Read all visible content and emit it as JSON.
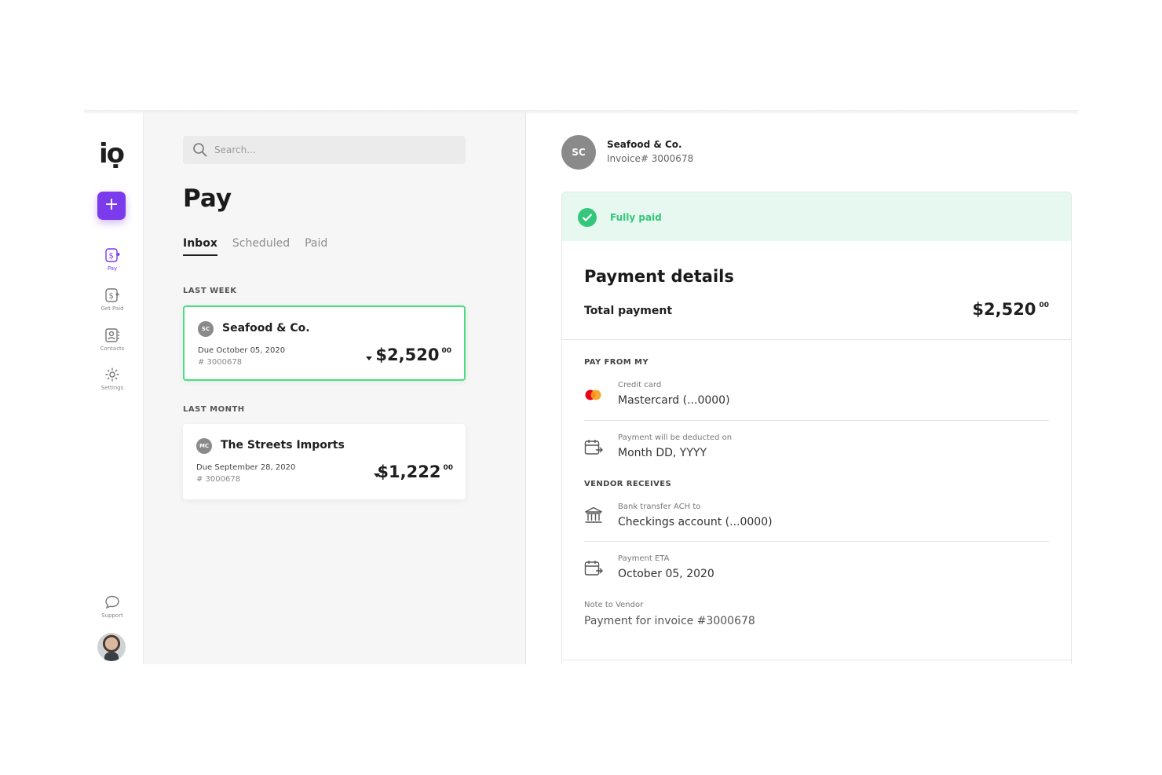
{
  "sidebar": {
    "logo": "iọ",
    "add_label": "+",
    "items": [
      {
        "label": "Pay",
        "icon": "pay-icon",
        "active": true
      },
      {
        "label": "Get Paid",
        "icon": "get-paid-icon",
        "active": false
      },
      {
        "label": "Contacts",
        "icon": "contacts-icon",
        "active": false
      },
      {
        "label": "Settings",
        "icon": "gear-icon",
        "active": false
      }
    ],
    "support_label": "Support"
  },
  "list": {
    "search_placeholder": "Search...",
    "title": "Pay",
    "tabs": [
      {
        "label": "Inbox",
        "active": true
      },
      {
        "label": "Scheduled",
        "active": false
      },
      {
        "label": "Paid",
        "active": false
      }
    ],
    "sections": [
      {
        "label": "LAST WEEK",
        "invoices": [
          {
            "initials": "SC",
            "vendor": "Seafood & Co.",
            "due": "Due October 05, 2020",
            "number": "# 3000678",
            "amount": "$2,520",
            "cents": "00",
            "selected": true
          }
        ]
      },
      {
        "label": "LAST MONTH",
        "invoices": [
          {
            "initials": "MC",
            "vendor": "The Streets Imports",
            "due": "Due September 28, 2020",
            "number": "# 3000678",
            "amount": "$1,222",
            "cents": "00",
            "selected": false
          }
        ]
      }
    ]
  },
  "detail": {
    "initials": "SC",
    "vendor": "Seafood & Co.",
    "invoice": "Invoice# 3000678",
    "status": "Fully paid",
    "title": "Payment details",
    "total_label": "Total payment",
    "total_amount": "$2,520",
    "total_cents": "00",
    "pay_from_label": "PAY FROM MY",
    "credit_card_label": "Credit card",
    "credit_card_value": "Mastercard (...0000)",
    "deducted_label": "Payment will be deducted on",
    "deducted_value": "Month DD, YYYY",
    "vendor_receives_label": "VENDOR RECEIVES",
    "bank_label": "Bank transfer ACH to",
    "bank_value": "Checkings account (...0000)",
    "eta_label": "Payment ETA",
    "eta_value": "October 05, 2020",
    "note_label": "Note to Vendor",
    "note_value": "Payment for invoice #3000678"
  },
  "colors": {
    "accent": "#7c3aed",
    "success": "#34c77b",
    "success_bg": "#e6f8ef",
    "selected_border": "#4ade80"
  }
}
